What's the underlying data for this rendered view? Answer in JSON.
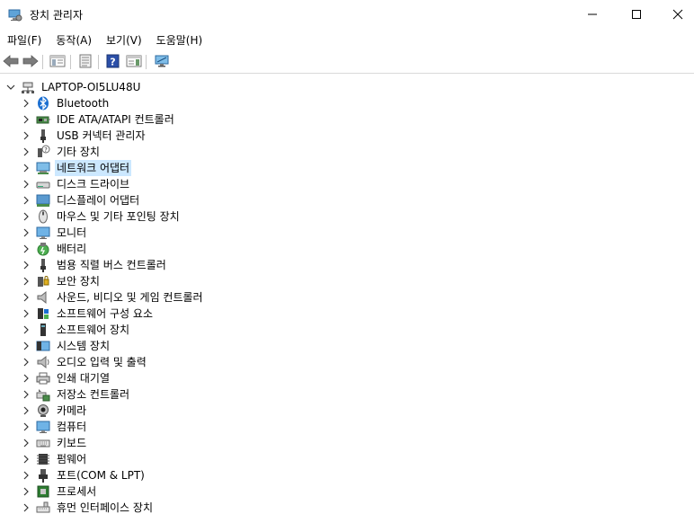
{
  "window": {
    "title": "장치 관리자",
    "controls": {
      "minimize": "—",
      "maximize": "□",
      "close": "✕"
    }
  },
  "menu": [
    "파일(F)",
    "동작(A)",
    "보기(V)",
    "도움말(H)"
  ],
  "toolbar": {
    "icons": [
      "back-arrow-icon",
      "forward-arrow-icon",
      "show-hide-tree-icon",
      "properties-icon",
      "help-icon",
      "action-pane-icon",
      "scan-hardware-icon"
    ]
  },
  "tree": {
    "root": "LAPTOP-OI5LU48U",
    "selected_index": 4,
    "items": [
      {
        "label": "Bluetooth",
        "icon": "bluetooth-icon"
      },
      {
        "label": "IDE ATA/ATAPI 컨트롤러",
        "icon": "ide-controller-icon"
      },
      {
        "label": "USB 커넥터 관리자",
        "icon": "usb-connector-icon"
      },
      {
        "label": "기타 장치",
        "icon": "other-devices-icon"
      },
      {
        "label": "네트워크 어댑터",
        "icon": "network-adapter-icon"
      },
      {
        "label": "디스크 드라이브",
        "icon": "disk-drive-icon"
      },
      {
        "label": "디스플레이 어댑터",
        "icon": "display-adapter-icon"
      },
      {
        "label": "마우스 및 기타 포인팅 장치",
        "icon": "mouse-icon"
      },
      {
        "label": "모니터",
        "icon": "monitor-icon"
      },
      {
        "label": "배터리",
        "icon": "battery-icon"
      },
      {
        "label": "범용 직렬 버스 컨트롤러",
        "icon": "usb-controller-icon"
      },
      {
        "label": "보안 장치",
        "icon": "security-device-icon"
      },
      {
        "label": "사운드, 비디오 및 게임 컨트롤러",
        "icon": "speaker-icon"
      },
      {
        "label": "소프트웨어 구성 요소",
        "icon": "software-component-icon"
      },
      {
        "label": "소프트웨어 장치",
        "icon": "software-device-icon"
      },
      {
        "label": "시스템 장치",
        "icon": "system-device-icon"
      },
      {
        "label": "오디오 입력 및 출력",
        "icon": "audio-io-icon"
      },
      {
        "label": "인쇄 대기열",
        "icon": "print-queue-icon"
      },
      {
        "label": "저장소 컨트롤러",
        "icon": "storage-controller-icon"
      },
      {
        "label": "카메라",
        "icon": "camera-icon"
      },
      {
        "label": "컴퓨터",
        "icon": "computer-icon"
      },
      {
        "label": "키보드",
        "icon": "keyboard-icon"
      },
      {
        "label": "펌웨어",
        "icon": "firmware-icon"
      },
      {
        "label": "포트(COM & LPT)",
        "icon": "port-icon"
      },
      {
        "label": "프로세서",
        "icon": "processor-icon"
      },
      {
        "label": "휴먼 인터페이스 장치",
        "icon": "hid-icon"
      }
    ]
  }
}
